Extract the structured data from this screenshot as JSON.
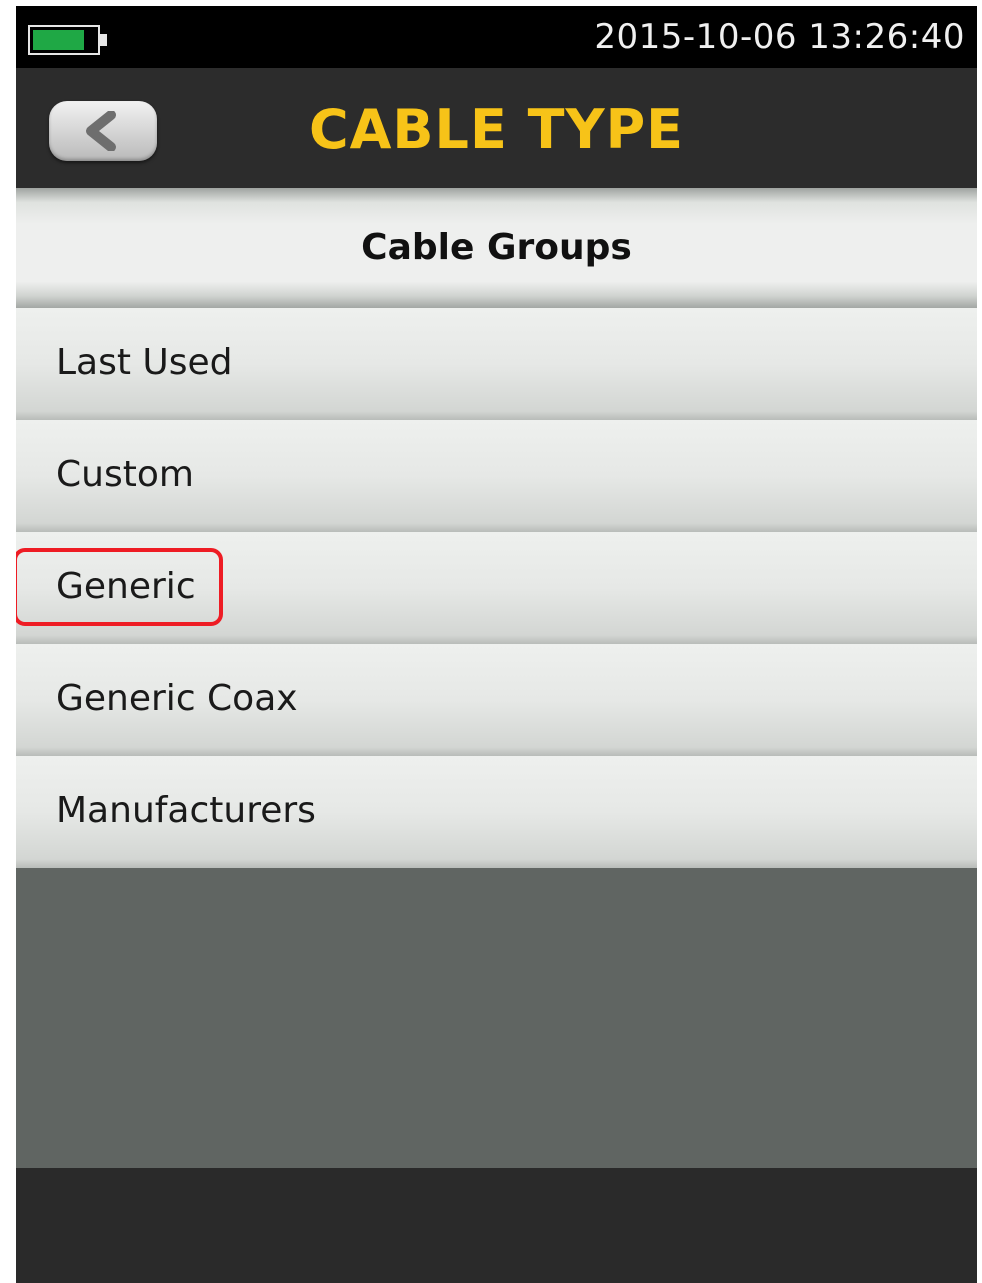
{
  "status_bar": {
    "datetime": "2015-10-06 13:26:40",
    "battery_level": 0.82,
    "battery_color": "#1fa845"
  },
  "header": {
    "title": "CABLE TYPE",
    "title_color": "#f7c318",
    "back_icon": "chevron-left-icon"
  },
  "section": {
    "title": "Cable Groups"
  },
  "cable_groups": [
    {
      "label": "Last Used"
    },
    {
      "label": "Custom"
    },
    {
      "label": "Generic",
      "highlighted": true
    },
    {
      "label": "Generic Coax"
    },
    {
      "label": "Manufacturers"
    }
  ],
  "highlight_color": "#ee1c24"
}
